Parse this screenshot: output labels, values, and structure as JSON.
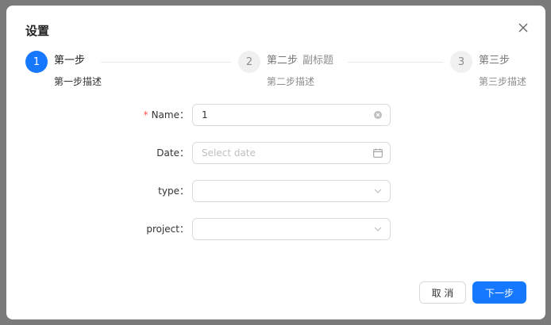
{
  "modal": {
    "title": "设置"
  },
  "steps": [
    {
      "number": "1",
      "title": "第一步",
      "subtitle": "",
      "description": "第一步描述",
      "status": "active"
    },
    {
      "number": "2",
      "title": "第二步",
      "subtitle": "副标题",
      "description": "第二步描述",
      "status": "wait"
    },
    {
      "number": "3",
      "title": "第三步",
      "subtitle": "",
      "description": "第三步描述",
      "status": "wait"
    }
  ],
  "form": {
    "name": {
      "label": "Name",
      "value": "1",
      "required": true
    },
    "date": {
      "label": "Date",
      "placeholder": "Select date"
    },
    "type": {
      "label": "type",
      "value": ""
    },
    "project": {
      "label": "project",
      "value": ""
    },
    "colon": "："
  },
  "footer": {
    "cancel_label": "取 消",
    "next_label": "下一步"
  },
  "colors": {
    "primary": "#1677ff",
    "required": "#ff4d4f",
    "overlay": "#7a7a7a"
  },
  "icons": {
    "close": "close-icon",
    "clear": "clear-circle-icon",
    "calendar": "calendar-icon",
    "dropdown": "chevron-down-icon"
  }
}
